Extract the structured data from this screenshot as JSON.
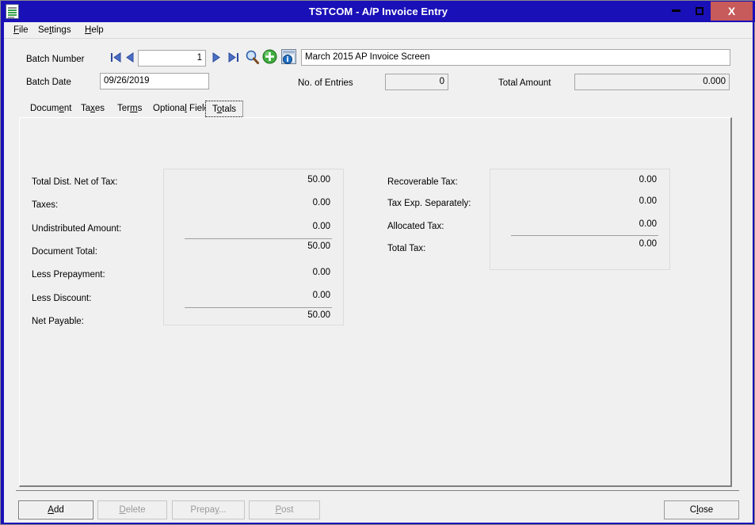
{
  "window": {
    "title": "TSTCOM - A/P Invoice Entry",
    "icon": "document-list-icon",
    "minimize_label": "minimize-icon",
    "maximize_label": "maximize-icon",
    "close_label": "X",
    "accent_color": "#1a10b8",
    "close_button_color": "#c75a5a"
  },
  "menubar": {
    "items": [
      {
        "label": "File",
        "accel_before": "",
        "accel": "F",
        "accel_after": "ile"
      },
      {
        "label": "Settings",
        "accel_before": "Se",
        "accel": "t",
        "accel_after": "tings"
      },
      {
        "label": "Help",
        "accel_before": "",
        "accel": "H",
        "accel_after": "elp"
      }
    ]
  },
  "header": {
    "batch_number_label": "Batch Number",
    "batch_number_value": "1",
    "batch_date_label": "Batch Date",
    "batch_date_value": "09/26/2019",
    "description_value": "March 2015 AP Invoice Screen",
    "description_placeholder": "",
    "entries_label": "No. of Entries",
    "entries_value": "0",
    "total_amount_label": "Total Amount",
    "total_amount_value": "0.000",
    "nav": {
      "first": "go-to-first-icon",
      "prev": "go-to-previous-icon",
      "next": "go-to-next-icon",
      "last": "go-to-last-icon",
      "find": "magnifier-finder-icon",
      "new": "new-plus-icon",
      "info": "zoom-data-info-icon"
    }
  },
  "tabs": [
    {
      "label": "Document",
      "accel_before": "Docum",
      "accel": "e",
      "accel_after": "nt",
      "active": false
    },
    {
      "label": "Taxes",
      "accel_before": "Ta",
      "accel": "x",
      "accel_after": "es",
      "active": false
    },
    {
      "label": "Terms",
      "accel_before": "Ter",
      "accel": "m",
      "accel_after": "s",
      "active": false
    },
    {
      "label": "Optional Fields",
      "accel_before": "Optiona",
      "accel": "l",
      "accel_after": " Fields",
      "active": false
    },
    {
      "label": "Totals",
      "accel_before": "T",
      "accel": "o",
      "accel_after": "tals",
      "active": true
    }
  ],
  "totals": {
    "left": [
      {
        "label": "Total Dist. Net of Tax:",
        "value": "50.00",
        "rule_above": false
      },
      {
        "label": "Taxes:",
        "value": "0.00",
        "rule_above": false
      },
      {
        "label": "Undistributed Amount:",
        "value": "0.00",
        "rule_above": false
      },
      {
        "label": "Document Total:",
        "value": "50.00",
        "rule_above": true
      },
      {
        "label": "Less Prepayment:",
        "value": "0.00",
        "rule_above": false
      },
      {
        "label": "Less Discount:",
        "value": "0.00",
        "rule_above": false
      },
      {
        "label": "Net Payable:",
        "value": "50.00",
        "rule_above": true
      }
    ],
    "right": [
      {
        "label": "Recoverable Tax:",
        "value": "0.00",
        "rule_above": false
      },
      {
        "label": "Tax Exp. Separately:",
        "value": "0.00",
        "rule_above": false
      },
      {
        "label": "Allocated Tax:",
        "value": "0.00",
        "rule_above": false
      },
      {
        "label": "Total Tax:",
        "value": "0.00",
        "rule_above": true
      }
    ]
  },
  "buttons": {
    "add": {
      "label": "Add",
      "accel_before": "",
      "accel": "A",
      "accel_after": "dd",
      "enabled": true,
      "focused": true
    },
    "delete": {
      "label": "Delete",
      "accel_before": "",
      "accel": "D",
      "accel_after": "elete",
      "enabled": false,
      "focused": false
    },
    "prepay": {
      "label": "Prepay...",
      "accel_before": "Prepa",
      "accel": "y",
      "accel_after": "...",
      "enabled": false,
      "focused": false
    },
    "post": {
      "label": "Post",
      "accel_before": "",
      "accel": "P",
      "accel_after": "ost",
      "enabled": false,
      "focused": false
    },
    "close": {
      "label": "Close",
      "accel_before": "C",
      "accel": "l",
      "accel_after": "ose",
      "enabled": true,
      "focused": false
    }
  }
}
